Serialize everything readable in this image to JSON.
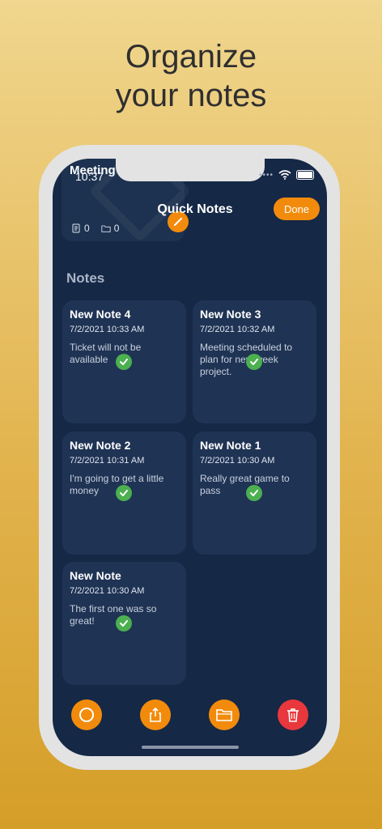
{
  "headline": {
    "line1": "Organize",
    "line2": "your notes"
  },
  "status_bar": {
    "time": "10:37",
    "signal": "••••"
  },
  "folder_card": {
    "title": "Meeting",
    "notes_count": "0",
    "folders_count": "0"
  },
  "header": {
    "title": "Quick Notes",
    "done_label": "Done"
  },
  "notes_section": {
    "title": "Notes"
  },
  "notes": [
    {
      "title": "New Note 4",
      "date": "7/2/2021 10:33 AM",
      "body": "Ticket will not be available"
    },
    {
      "title": "New Note 3",
      "date": "7/2/2021 10:32 AM",
      "body": "Meeting scheduled to plan for new week project."
    },
    {
      "title": "New Note 2",
      "date": "7/2/2021 10:31 AM",
      "body": "I'm going to get a little money"
    },
    {
      "title": "New Note 1",
      "date": "7/2/2021 10:30 AM",
      "body": "Really great game to pass"
    },
    {
      "title": "New Note",
      "date": "7/2/2021 10:30 AM",
      "body": "The first one was so great!"
    }
  ],
  "toolbar": {
    "items": [
      {
        "icon": "circle-icon"
      },
      {
        "icon": "share-icon"
      },
      {
        "icon": "folder-icon"
      },
      {
        "icon": "trash-icon"
      }
    ]
  },
  "colors": {
    "accent": "#f28b0c",
    "danger": "#e8383d",
    "check": "#4caf50",
    "background": "#152846",
    "card": "#1f3354"
  }
}
